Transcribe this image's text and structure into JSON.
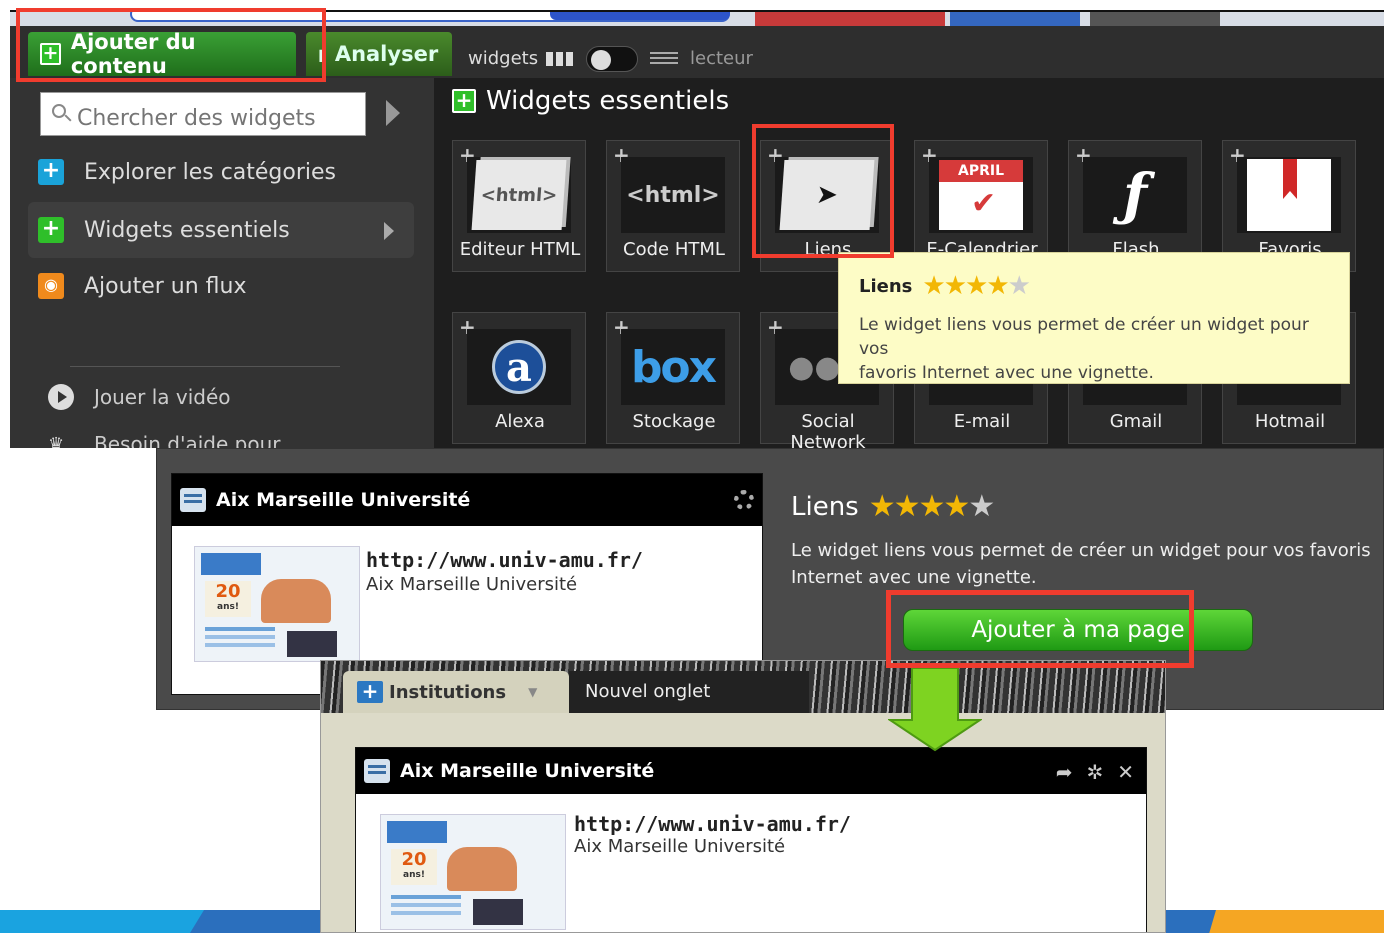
{
  "topbar": {
    "add_content_label": "Ajouter du contenu",
    "analyse_label": "Analyser",
    "mode_widgets": "widgets",
    "mode_lecteur": "lecteur"
  },
  "sidebar": {
    "search_placeholder": "Chercher des widgets",
    "items": [
      {
        "label": "Explorer les catégories"
      },
      {
        "label": "Widgets essentiels"
      },
      {
        "label": "Ajouter un flux"
      }
    ],
    "video_label": "Jouer la vidéo",
    "help_label": "Besoin d'aide pour"
  },
  "content": {
    "title": "Widgets essentiels",
    "widgets": [
      {
        "label": "Editeur HTML",
        "icon": "html-editor-icon"
      },
      {
        "label": "Code HTML",
        "icon": "html-code-icon"
      },
      {
        "label": "Liens",
        "icon": "links-icon"
      },
      {
        "label": "E-Calendrier",
        "icon": "calendar-icon",
        "month": "APRIL"
      },
      {
        "label": "Flash",
        "icon": "flash-icon"
      },
      {
        "label": "Favoris",
        "icon": "bookmark-icon"
      },
      {
        "label": "Alexa",
        "icon": "alexa-icon"
      },
      {
        "label": "Stockage",
        "icon": "box-icon"
      },
      {
        "label": "Social Network",
        "icon": "social-network-icon"
      },
      {
        "label": "E-mail",
        "icon": "email-icon"
      },
      {
        "label": "Gmail",
        "icon": "gmail-icon"
      },
      {
        "label": "Hotmail",
        "icon": "hotmail-icon"
      }
    ]
  },
  "tooltip": {
    "title": "Liens",
    "rating": 4,
    "desc_line1": "Le widget liens vous permet de créer un widget pour vos",
    "desc_line2": "favoris Internet avec une vignette."
  },
  "detail": {
    "card_title": "Aix Marseille Université",
    "card_url": "http://www.univ-amu.fr/",
    "card_name": "Aix Marseille Université",
    "title": "Liens",
    "rating": 4,
    "desc_line1": "Le widget liens vous permet de créer un widget pour vos favoris",
    "desc_line2": "Internet avec une vignette.",
    "add_button": "Ajouter à ma page"
  },
  "page": {
    "tab_active": "Institutions",
    "tab_new": "Nouvel onglet",
    "card_title": "Aix Marseille Université",
    "card_url": "http://www.univ-amu.fr/",
    "card_name": "Aix Marseille Université"
  },
  "colors": {
    "highlight": "#f03c2e",
    "green": "#2fbf2a",
    "tooltip_bg": "#fdfcc6",
    "arrow": "#7ed321"
  },
  "thumb_text": {
    "big": "20",
    "small": "ans!"
  }
}
